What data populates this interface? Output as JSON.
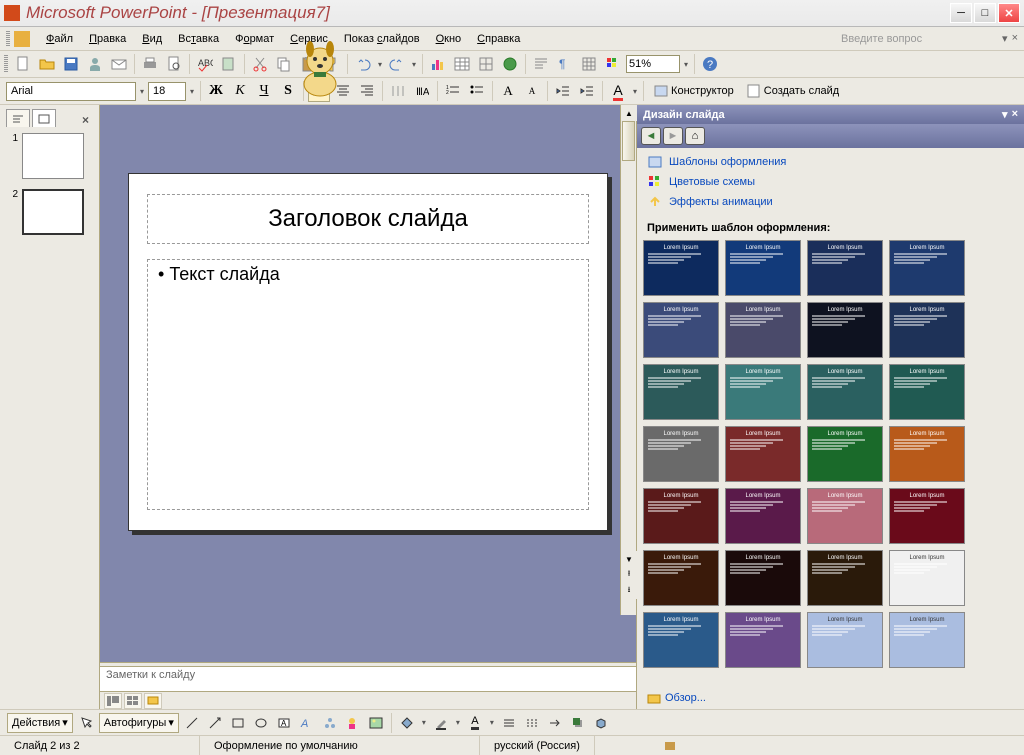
{
  "title": "Microsoft PowerPoint - [Презентация7]",
  "menu": [
    "Файл",
    "Правка",
    "Вид",
    "Вставка",
    "Формат",
    "Сервис",
    "Показ слайдов",
    "Окно",
    "Справка"
  ],
  "menu_underline": [
    0,
    0,
    0,
    2,
    1,
    0,
    6,
    0,
    0
  ],
  "qhelp": "Введите вопрос",
  "zoom": "51%",
  "font": {
    "name": "Arial",
    "size": "18"
  },
  "fmt": {
    "designer": "Конструктор",
    "newslide": "Создать слайд"
  },
  "thumbs": [
    {
      "n": "1"
    },
    {
      "n": "2"
    }
  ],
  "slide": {
    "title": "Заголовок слайда",
    "body": "Текст слайда"
  },
  "notes": "Заметки к слайду",
  "taskpane": {
    "title": "Дизайн слайда",
    "links": [
      "Шаблоны оформления",
      "Цветовые схемы",
      "Эффекты анимации"
    ],
    "apply": "Применить шаблон оформления:",
    "browse": "Обзор..."
  },
  "templates_colors": [
    "#0d2a5e",
    "#123a7a",
    "#1a2e5a",
    "#1e3a6e",
    "#3b4b7a",
    "#4a4a6a",
    "#0e1220",
    "#1e3258",
    "#2c5a5a",
    "#3a7a7a",
    "#2a6060",
    "#205a52",
    "#6a6a6a",
    "#7a2a2a",
    "#1a6a2a",
    "#b85a1a",
    "#5a1a1a",
    "#5a1a4a",
    "#b86a7a",
    "#6a0a1a",
    "#3a1a0a",
    "#1a0a0a",
    "#2a1a0a",
    "#f0f0f0",
    "#2a5a8a",
    "#6a4a8a",
    "#aabde0",
    "#aabde0"
  ],
  "draw": {
    "actions": "Действия",
    "autoshapes": "Автофигуры"
  },
  "status": {
    "slide": "Слайд 2 из 2",
    "design": "Оформление по умолчанию",
    "lang": "русский (Россия)"
  }
}
